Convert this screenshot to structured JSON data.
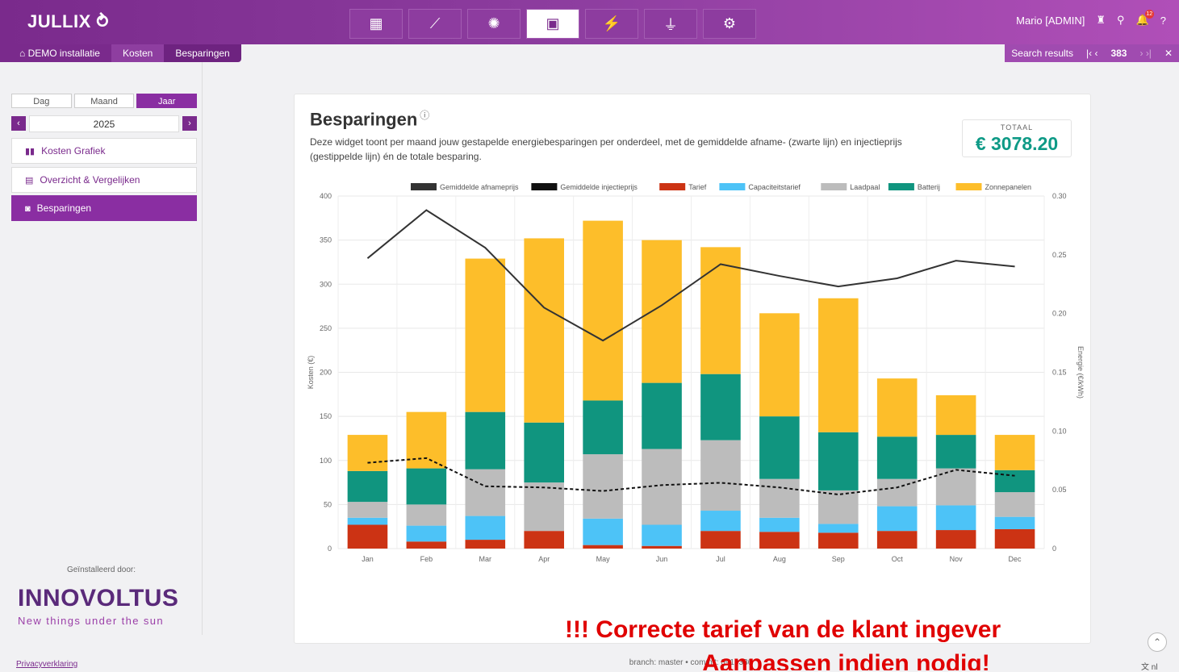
{
  "app": {
    "logo": "JULLIX"
  },
  "nav": [
    {
      "icon": "dashboard-icon",
      "glyph": "▦"
    },
    {
      "icon": "line-chart-icon",
      "glyph": "⟋"
    },
    {
      "icon": "brain-icon",
      "glyph": "✺"
    },
    {
      "icon": "money-icon",
      "glyph": "▣"
    },
    {
      "icon": "battery-icon",
      "glyph": "⚡"
    },
    {
      "icon": "plug-icon",
      "glyph": "⏚"
    },
    {
      "icon": "gear-icon",
      "glyph": "⚙"
    }
  ],
  "user": {
    "name": "Mario [ADMIN]",
    "notifications": "12"
  },
  "breadcrumb": {
    "home": "DEMO installatie",
    "level2": "Kosten",
    "level3": "Besparingen"
  },
  "search": {
    "label": "Search results",
    "count": "383"
  },
  "sidebar": {
    "period_day": "Dag",
    "period_month": "Maand",
    "period_year": "Jaar",
    "year": "2025",
    "menu_costs": "Kosten Grafiek",
    "menu_compare": "Overzicht & Vergelijken",
    "menu_savings": "Besparingen",
    "installed_by": "Geïnstalleerd door:",
    "installer_name": "INNOVOLTUS",
    "installer_tagline": "New things under the sun",
    "privacy": "Privacyverklaring"
  },
  "card": {
    "title": "Besparingen",
    "description": "Deze widget toont per maand jouw gestapelde energiebesparingen per onderdeel, met de gemiddelde afname- (zwarte lijn) en injectieprijs (gestippelde lijn) én de totale besparing.",
    "total_label": "TOTAAL",
    "total_value": "€ 3078.20"
  },
  "footer": {
    "build": "branch: master • commit: 0919336",
    "lang": "nl"
  },
  "banner": {
    "line1": "!!! Correcte tarief van de klant ingever",
    "line2": "Aanpassen indien nodig!"
  },
  "colors": {
    "purple": "#7a2a8c",
    "tarief": "#cc3314",
    "capaciteit": "#4dc3f7",
    "laadpaal": "#bcbcbc",
    "batterij": "#10957f",
    "zonne": "#fdbe2a",
    "total": "#0e9a86"
  },
  "chart_data": {
    "type": "bar",
    "categories": [
      "Jan",
      "Feb",
      "Mar",
      "Apr",
      "May",
      "Jun",
      "Jul",
      "Aug",
      "Sep",
      "Oct",
      "Nov",
      "Dec"
    ],
    "ylabel": "Kosten (€)",
    "y2label": "Energie (€/kWh)",
    "ylim": [
      0,
      400
    ],
    "y2lim": [
      0,
      0.3
    ],
    "yticks": [
      0,
      50,
      100,
      150,
      200,
      250,
      300,
      350,
      400
    ],
    "y2ticks": [
      "0",
      "0.05",
      "0.10",
      "0.15",
      "0.20",
      "0.25",
      "0.30"
    ],
    "legend_position": "top",
    "stacked": true,
    "series": [
      {
        "name": "Tarief",
        "color": "#cc3314",
        "values": [
          27,
          8,
          10,
          20,
          4,
          3,
          20,
          19,
          18,
          20,
          21,
          22
        ]
      },
      {
        "name": "Capaciteitstarief",
        "color": "#4dc3f7",
        "values": [
          8,
          18,
          27,
          0,
          30,
          24,
          23,
          16,
          10,
          28,
          28,
          14
        ]
      },
      {
        "name": "Laadpaal",
        "color": "#bcbcbc",
        "values": [
          18,
          24,
          53,
          55,
          73,
          86,
          80,
          44,
          38,
          31,
          42,
          28
        ]
      },
      {
        "name": "Batterij",
        "color": "#10957f",
        "values": [
          35,
          41,
          65,
          68,
          61,
          75,
          75,
          71,
          66,
          48,
          38,
          25
        ]
      },
      {
        "name": "Zonnepanelen",
        "color": "#fdbe2a",
        "values": [
          41,
          64,
          174,
          209,
          204,
          162,
          144,
          117,
          152,
          66,
          45,
          40
        ]
      }
    ],
    "lines": [
      {
        "name": "Gemiddelde afnameprijs",
        "color": "#333333",
        "style": "solid",
        "values": [
          0.247,
          0.288,
          0.256,
          0.205,
          0.177,
          0.207,
          0.242,
          0.232,
          0.223,
          0.23,
          0.245,
          0.24
        ]
      },
      {
        "name": "Gemiddelde injectieprijs",
        "color": "#111111",
        "style": "dashed",
        "values": [
          0.073,
          0.077,
          0.053,
          0.052,
          0.049,
          0.054,
          0.056,
          0.052,
          0.046,
          0.052,
          0.067,
          0.062
        ]
      }
    ]
  }
}
